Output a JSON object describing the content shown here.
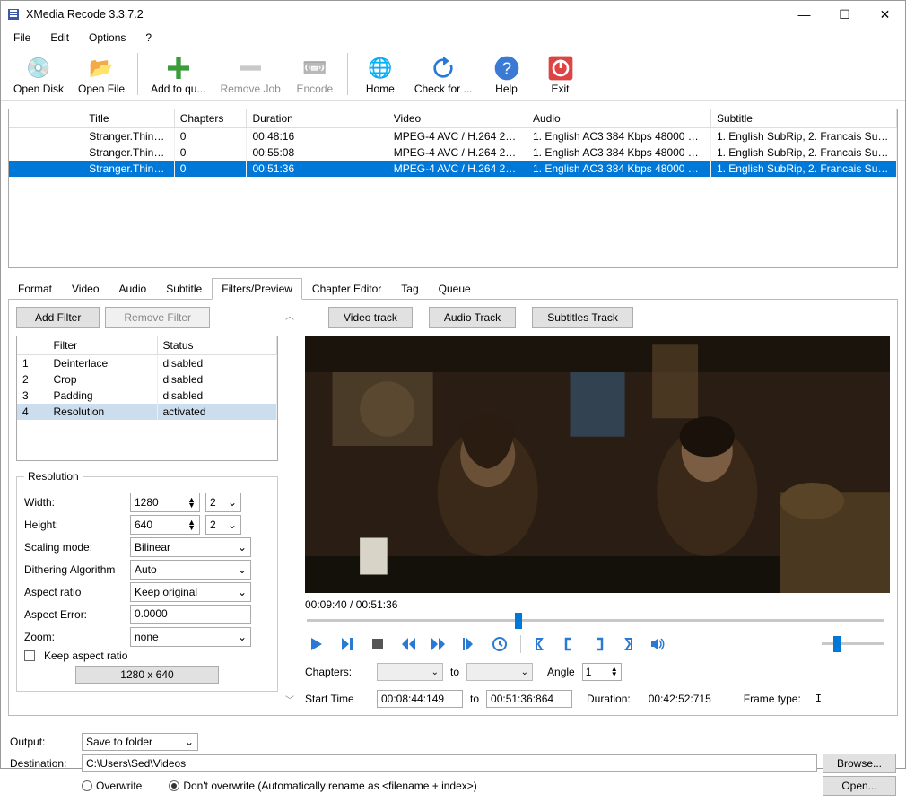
{
  "window": {
    "title": "XMedia Recode 3.3.7.2"
  },
  "menu": {
    "file": "File",
    "edit": "Edit",
    "options": "Options",
    "help": "?"
  },
  "toolbar": {
    "open_disk": "Open Disk",
    "open_file": "Open File",
    "add_queue": "Add to qu...",
    "remove_job": "Remove Job",
    "encode": "Encode",
    "home": "Home",
    "check": "Check for ...",
    "help": "Help",
    "exit": "Exit"
  },
  "filelist": {
    "headers": {
      "title": "Title",
      "chapters": "Chapters",
      "duration": "Duration",
      "video": "Video",
      "audio": "Audio",
      "subtitle": "Subtitle"
    },
    "rows": [
      {
        "title": "Stranger.Things...",
        "chapters": "0",
        "duration": "00:48:16",
        "video": "MPEG-4 AVC / H.264 23.9...",
        "audio": "1. English AC3 384 Kbps 48000 Hz 6 ...",
        "subtitle": "1. English SubRip, 2. Francais SubRi..."
      },
      {
        "title": "Stranger.Things...",
        "chapters": "0",
        "duration": "00:55:08",
        "video": "MPEG-4 AVC / H.264 23.9...",
        "audio": "1. English AC3 384 Kbps 48000 Hz 6 ...",
        "subtitle": "1. English SubRip, 2. Francais SubRi..."
      },
      {
        "title": "Stranger.Things...",
        "chapters": "0",
        "duration": "00:51:36",
        "video": "MPEG-4 AVC / H.264 23.9...",
        "audio": "1. English AC3 384 Kbps 48000 Hz 6 ...",
        "subtitle": "1. English SubRip, 2. Francais SubRi..."
      }
    ]
  },
  "tabs": {
    "format": "Format",
    "video": "Video",
    "audio": "Audio",
    "subtitle": "Subtitle",
    "filters": "Filters/Preview",
    "chapter": "Chapter Editor",
    "tag": "Tag",
    "queue": "Queue"
  },
  "filterbtns": {
    "add": "Add Filter",
    "remove": "Remove Filter"
  },
  "filterlist": {
    "headers": {
      "num": "",
      "filter": "Filter",
      "status": "Status"
    },
    "rows": [
      {
        "num": "1",
        "filter": "Deinterlace",
        "status": "disabled"
      },
      {
        "num": "2",
        "filter": "Crop",
        "status": "disabled"
      },
      {
        "num": "3",
        "filter": "Padding",
        "status": "disabled"
      },
      {
        "num": "4",
        "filter": "Resolution",
        "status": "activated"
      }
    ]
  },
  "res": {
    "legend": "Resolution",
    "width_lbl": "Width:",
    "width_val": "1280",
    "width_fac": "2",
    "height_lbl": "Height:",
    "height_val": "640",
    "height_fac": "2",
    "scale_lbl": "Scaling mode:",
    "scale_val": "Bilinear",
    "dither_lbl": "Dithering Algorithm",
    "dither_val": "Auto",
    "aspect_lbl": "Aspect ratio",
    "aspect_val": "Keep original",
    "err_lbl": "Aspect Error:",
    "err_val": "0.0000",
    "zoom_lbl": "Zoom:",
    "zoom_val": "none",
    "keep_lbl": "Keep aspect ratio",
    "dim_btn": "1280 x 640"
  },
  "tracks": {
    "video": "Video track",
    "audio": "Audio Track",
    "subs": "Subtitles Track"
  },
  "preview": {
    "time": "00:09:40 / 00:51:36",
    "chapters_lbl": "Chapters:",
    "to": "to",
    "angle_lbl": "Angle",
    "angle_val": "1",
    "start_lbl": "Start Time",
    "start_val": "00:08:44:149",
    "end_val": "00:51:36:864",
    "dur_lbl": "Duration:",
    "dur_val": "00:42:52:715",
    "ftype_lbl": "Frame type:",
    "ftype_val": "I"
  },
  "bottom": {
    "output_lbl": "Output:",
    "output_val": "Save to folder",
    "dest_lbl": "Destination:",
    "dest_val": "C:\\Users\\Sed\\Videos",
    "browse": "Browse...",
    "open": "Open...",
    "overwrite": "Overwrite",
    "no_overwrite": "Don't overwrite (Automatically rename as <filename + index>)"
  }
}
